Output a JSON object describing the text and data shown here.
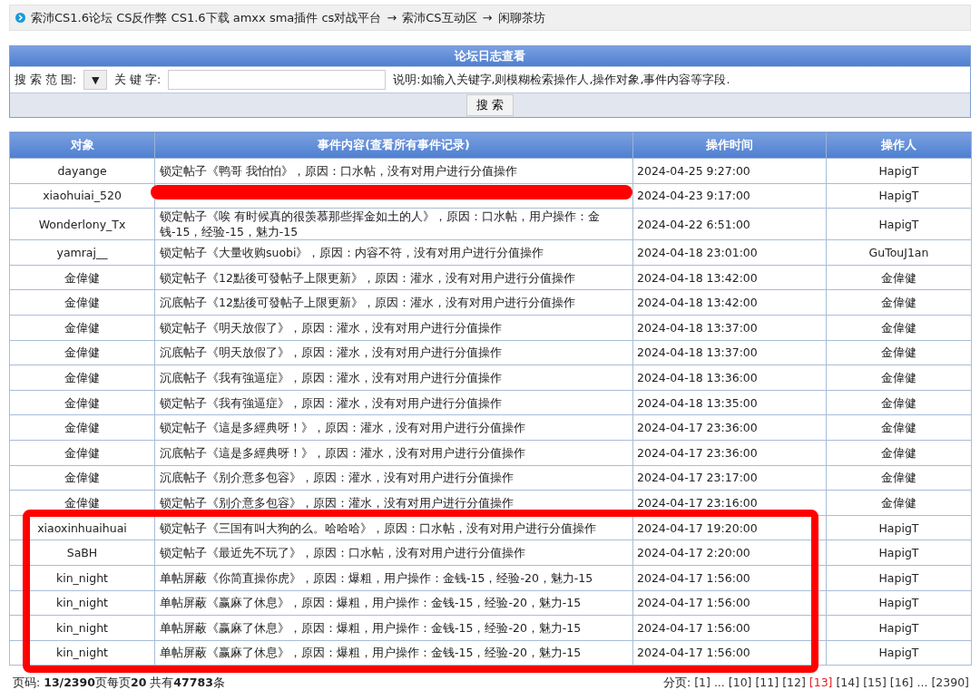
{
  "breadcrumb": {
    "items": [
      "索沛CS1.6论坛 CS反作弊 CS1.6下载 amxx sma插件 cs对战平台",
      "索沛CS互动区",
      "闲聊茶坊"
    ],
    "separator": "→"
  },
  "search_panel": {
    "title": "论坛日志查看",
    "scope_label": "搜 索 范 围:",
    "scope_select": "▼",
    "keyword_label": "关 键 字:",
    "note": "说明:如输入关键字,则模糊检索操作人,操作对象,事件内容等字段.",
    "button": "搜 索"
  },
  "table": {
    "columns": [
      "对象",
      "事件内容(查看所有事件记录)",
      "操作时间",
      "操作人"
    ],
    "rows": [
      {
        "target": "dayange",
        "event": "锁定帖子《鸭哥 我怕怕》，原因：口水帖，没有对用户进行分值操作",
        "time": "2024-04-25 9:27:00",
        "operator": "HapigT"
      },
      {
        "target": "xiaohuiai_520",
        "time": "2024-04-23 9:17:00",
        "operator": "HapigT",
        "struck": true
      },
      {
        "target": "Wonderlony_Tx",
        "event": "锁定帖子《唉 有时候真的很羡慕那些挥金如土的人》，原因：口水帖，用户操作：金钱-15，经验-15，魅力-15",
        "time": "2024-04-22 6:51:00",
        "operator": "HapigT"
      },
      {
        "target": "yamraj__",
        "event": "锁定帖子《大量收购suobi》，原因：内容不符，没有对用户进行分值操作",
        "time": "2024-04-18 23:01:00",
        "operator": "GuTouJ1an"
      },
      {
        "target": "金偉健",
        "event": "锁定帖子《12點後可發帖子上限更新》，原因：灌水，没有对用户进行分值操作",
        "time": "2024-04-18 13:42:00",
        "operator": "金偉健"
      },
      {
        "target": "金偉健",
        "event": "沉底帖子《12點後可發帖子上限更新》，原因：灌水，没有对用户进行分值操作",
        "time": "2024-04-18 13:42:00",
        "operator": "金偉健"
      },
      {
        "target": "金偉健",
        "event": "锁定帖子《明天放假了》，原因：灌水，没有对用户进行分值操作",
        "time": "2024-04-18 13:37:00",
        "operator": "金偉健"
      },
      {
        "target": "金偉健",
        "event": "沉底帖子《明天放假了》，原因：灌水，没有对用户进行分值操作",
        "time": "2024-04-18 13:37:00",
        "operator": "金偉健"
      },
      {
        "target": "金偉健",
        "event": "沉底帖子《我有強逼症》，原因：灌水，没有对用户进行分值操作",
        "time": "2024-04-18 13:36:00",
        "operator": "金偉健"
      },
      {
        "target": "金偉健",
        "event": "锁定帖子《我有強逼症》，原因：灌水，没有对用户进行分值操作",
        "time": "2024-04-18 13:35:00",
        "operator": "金偉健"
      },
      {
        "target": "金偉健",
        "event": "锁定帖子《這是多經典呀！》，原因：灌水，没有对用户进行分值操作",
        "time": "2024-04-17 23:36:00",
        "operator": "金偉健"
      },
      {
        "target": "金偉健",
        "event": "沉底帖子《這是多經典呀！》，原因：灌水，没有对用户进行分值操作",
        "time": "2024-04-17 23:36:00",
        "operator": "金偉健"
      },
      {
        "target": "金偉健",
        "event": "沉底帖子《别介意多包容》，原因：灌水，没有对用户进行分值操作",
        "time": "2024-04-17 23:17:00",
        "operator": "金偉健"
      },
      {
        "target": "金偉健",
        "event": "锁定帖子《别介意多包容》，原因：灌水，没有对用户进行分值操作",
        "time": "2024-04-17 23:16:00",
        "operator": "金偉健"
      },
      {
        "target": "xiaoxinhuaihuai",
        "event": "锁定帖子《三国有叫大狗的么。哈哈哈》，原因：口水帖，没有对用户进行分值操作",
        "time": "2024-04-17 19:20:00",
        "operator": "HapigT"
      },
      {
        "target": "SaBH",
        "event": "锁定帖子《最近先不玩了》，原因：口水帖，没有对用户进行分值操作",
        "time": "2024-04-17 2:20:00",
        "operator": "HapigT"
      },
      {
        "target": "kin_night",
        "event": "单帖屏蔽《你简直操你虎》，原因：爆粗，用户操作：金钱-15，经验-20，魅力-15",
        "time": "2024-04-17 1:56:00",
        "operator": "HapigT"
      },
      {
        "target": "kin_night",
        "event": "单帖屏蔽《赢麻了休息》，原因：爆粗，用户操作：金钱-15，经验-20，魅力-15",
        "time": "2024-04-17 1:56:00",
        "operator": "HapigT"
      },
      {
        "target": "kin_night",
        "event": "单帖屏蔽《赢麻了休息》，原因：爆粗，用户操作：金钱-15，经验-20，魅力-15",
        "time": "2024-04-17 1:56:00",
        "operator": "HapigT"
      },
      {
        "target": "kin_night",
        "event": "单帖屏蔽《赢麻了休息》，原因：爆粗，用户操作：金钱-15，经验-20，魅力-15",
        "time": "2024-04-17 1:56:00",
        "operator": "HapigT"
      }
    ]
  },
  "footer": {
    "summary": "页码: **13/2390**页每页**20** 共有**47783**条",
    "pager_label": "分页:",
    "pages": [
      {
        "label": "[1]",
        "selected": false
      },
      {
        "label": "...",
        "selected": false
      },
      {
        "label": "[10]",
        "selected": false
      },
      {
        "label": "[11]",
        "selected": false
      },
      {
        "label": "[12]",
        "selected": false
      },
      {
        "label": "[13]",
        "selected": true
      },
      {
        "label": "[14]",
        "selected": false
      },
      {
        "label": "[15]",
        "selected": false
      },
      {
        "label": "[16]",
        "selected": false
      },
      {
        "label": "...",
        "selected": false
      },
      {
        "label": "[2390]",
        "selected": false
      }
    ]
  },
  "highlight_frame": {
    "kind": "frame"
  }
}
